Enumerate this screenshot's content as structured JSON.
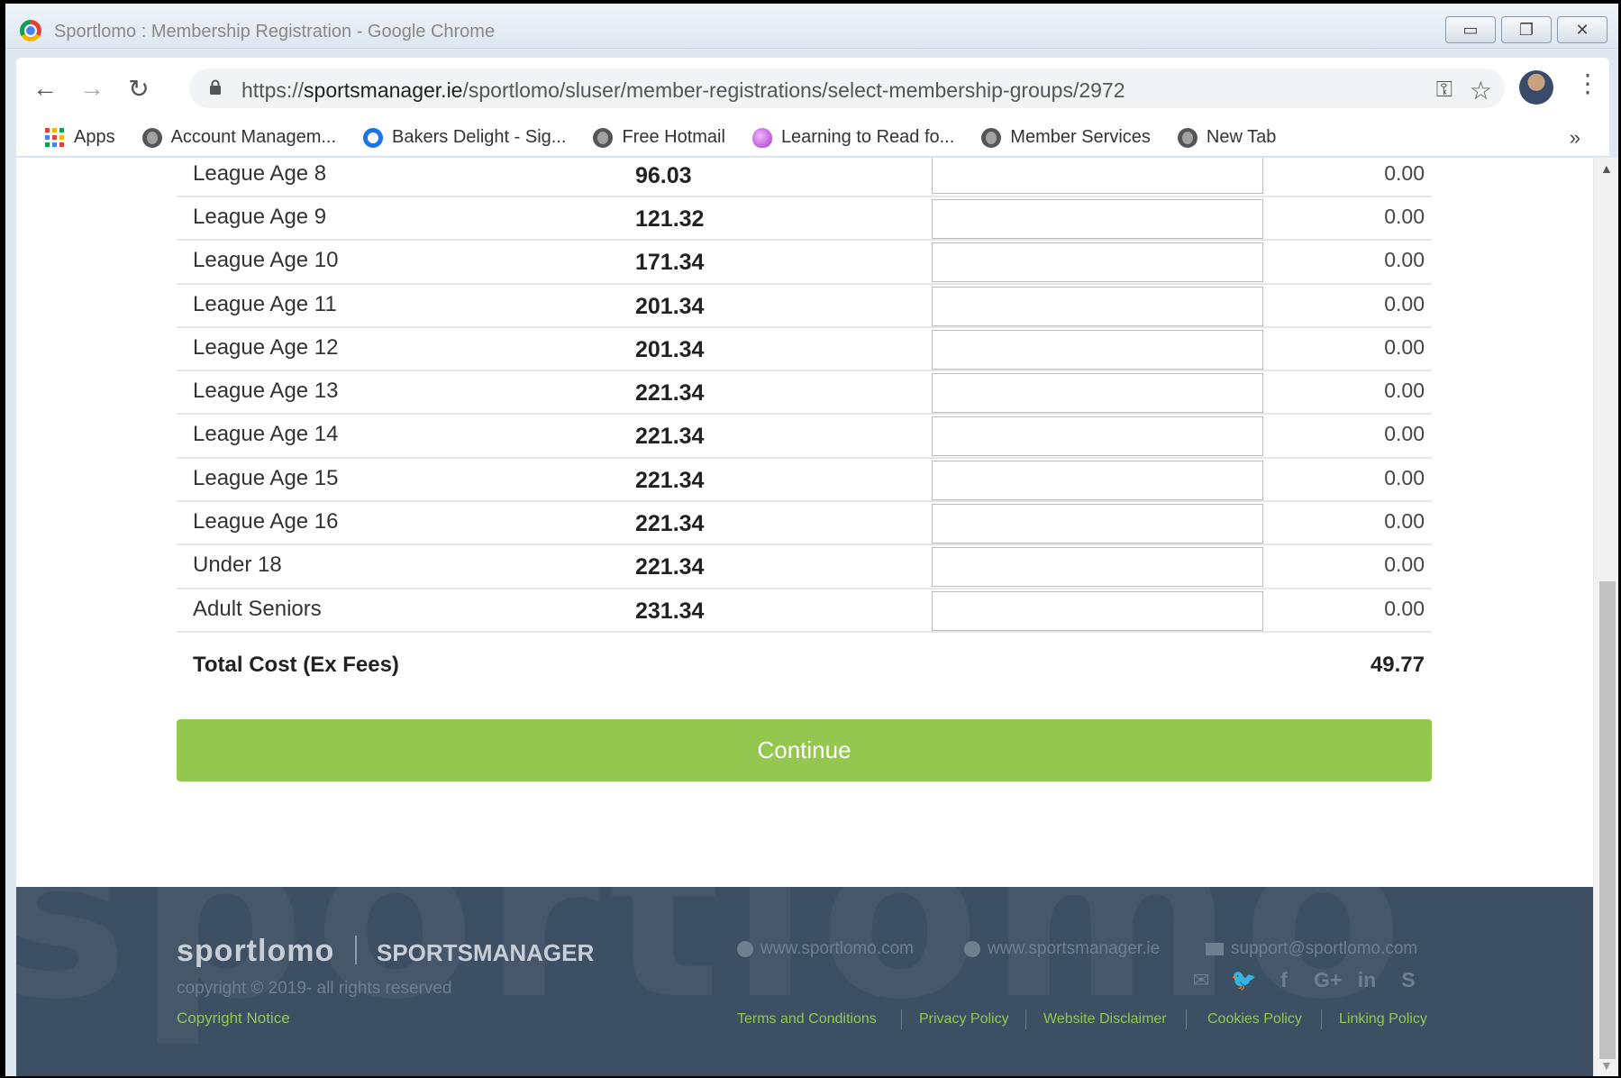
{
  "window": {
    "title": "Sportlomo : Membership Registration - Google Chrome",
    "controls": {
      "minimize": "▭",
      "restore": "❐",
      "close": "✕"
    }
  },
  "toolbar": {
    "back_icon": "←",
    "forward_icon": "→",
    "reload_icon": "↻",
    "url_scheme": "https://",
    "url_host": "sportsmanager.ie",
    "url_path": "/sportlomo/sluser/member-registrations/select-membership-groups/2972",
    "key_icon": "⚿",
    "star_icon": "☆",
    "menu_icon": "⋮"
  },
  "bookmarks": [
    {
      "label": "Apps",
      "icon": "apps-grid"
    },
    {
      "label": "Account Managem...",
      "icon": "globe"
    },
    {
      "label": "Bakers Delight - Sig...",
      "icon": "outlook"
    },
    {
      "label": "Free Hotmail",
      "icon": "globe"
    },
    {
      "label": "Learning to Read fo...",
      "icon": "egg"
    },
    {
      "label": "Member Services",
      "icon": "globe"
    },
    {
      "label": "New Tab",
      "icon": "globe"
    }
  ],
  "bookmarks_more": "»",
  "groups": [
    {
      "name": "League Age 8",
      "price": "96.03",
      "qty": "",
      "subtotal": "0.00"
    },
    {
      "name": "League Age 9",
      "price": "121.32",
      "qty": "",
      "subtotal": "0.00"
    },
    {
      "name": "League Age 10",
      "price": "171.34",
      "qty": "",
      "subtotal": "0.00"
    },
    {
      "name": "League Age 11",
      "price": "201.34",
      "qty": "",
      "subtotal": "0.00"
    },
    {
      "name": "League Age 12",
      "price": "201.34",
      "qty": "",
      "subtotal": "0.00"
    },
    {
      "name": "League Age 13",
      "price": "221.34",
      "qty": "",
      "subtotal": "0.00"
    },
    {
      "name": "League Age 14",
      "price": "221.34",
      "qty": "",
      "subtotal": "0.00"
    },
    {
      "name": "League Age 15",
      "price": "221.34",
      "qty": "",
      "subtotal": "0.00"
    },
    {
      "name": "League Age 16",
      "price": "221.34",
      "qty": "",
      "subtotal": "0.00"
    },
    {
      "name": "Under 18",
      "price": "221.34",
      "qty": "",
      "subtotal": "0.00"
    },
    {
      "name": "Adult Seniors",
      "price": "231.34",
      "qty": "",
      "subtotal": "0.00"
    }
  ],
  "total": {
    "label": "Total Cost (Ex Fees)",
    "value": "49.77"
  },
  "continue_label": "Continue",
  "footer": {
    "watermark": "sportlomo",
    "brand": "sportlomo",
    "brand_secondary": "SPORTSMANAGER",
    "copyright": "copyright © 2019- all rights reserved",
    "copyright_notice": "Copyright Notice",
    "site1": "www.sportlomo.com",
    "site2": "www.sportsmanager.ie",
    "email": "support@sportlomo.com",
    "socials": [
      "✉",
      "🐦",
      "f",
      "G+",
      "in",
      "S"
    ],
    "legal": [
      "Terms and Conditions",
      "Privacy Policy",
      "Website Disclaimer",
      "Cookies Policy",
      "Linking Policy"
    ]
  },
  "colors": {
    "accent_green": "#93c74f",
    "footer_bg": "#3d4f63"
  }
}
